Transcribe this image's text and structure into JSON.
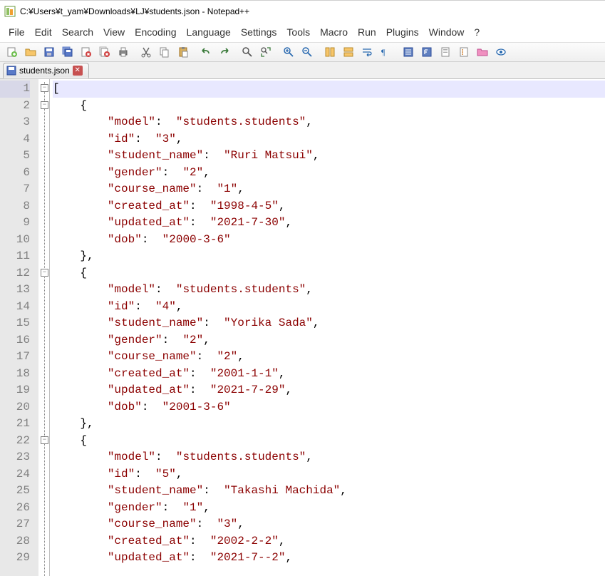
{
  "window": {
    "title": "C:¥Users¥t_yam¥Downloads¥LJ¥students.json - Notepad++"
  },
  "menu": {
    "file": "File",
    "edit": "Edit",
    "search": "Search",
    "view": "View",
    "encoding": "Encoding",
    "language": "Language",
    "settings": "Settings",
    "tools": "Tools",
    "macro": "Macro",
    "run": "Run",
    "plugins": "Plugins",
    "window": "Window",
    "help": "?"
  },
  "tab": {
    "label": "students.json"
  },
  "toolbar_icons": [
    "new-file-icon",
    "open-folder-icon",
    "save-icon",
    "save-all-icon",
    "close-icon",
    "close-all-icon",
    "print-icon",
    "cut-icon",
    "copy-icon",
    "paste-icon",
    "undo-icon",
    "redo-icon",
    "find-icon",
    "replace-icon",
    "zoom-in-icon",
    "zoom-out-icon",
    "sync-v-icon",
    "sync-h-icon",
    "wordwrap-icon",
    "allchars-icon",
    "indent-guide-icon",
    "lang-icon",
    "doc-map-icon",
    "func-list-icon",
    "folder-workspace-icon",
    "monitor-icon"
  ],
  "editor": {
    "gutter": [
      "1",
      "2",
      "3",
      "4",
      "5",
      "6",
      "7",
      "8",
      "9",
      "10",
      "11",
      "12",
      "13",
      "14",
      "15",
      "16",
      "17",
      "18",
      "19",
      "20",
      "21",
      "22",
      "23",
      "24",
      "25",
      "26",
      "27",
      "28",
      "29"
    ],
    "lines": [
      {
        "tokens": [
          {
            "t": "[",
            "c": "pun"
          }
        ],
        "indent": 0,
        "hl": true
      },
      {
        "tokens": [
          {
            "t": "{",
            "c": "pun"
          }
        ],
        "indent": 1
      },
      {
        "tokens": [
          {
            "t": "\"model\"",
            "c": "str"
          },
          {
            "t": ":  ",
            "c": "pun"
          },
          {
            "t": "\"students.students\"",
            "c": "str"
          },
          {
            "t": ",",
            "c": "pun"
          }
        ],
        "indent": 2
      },
      {
        "tokens": [
          {
            "t": "\"id\"",
            "c": "str"
          },
          {
            "t": ":  ",
            "c": "pun"
          },
          {
            "t": "\"3\"",
            "c": "str"
          },
          {
            "t": ",",
            "c": "pun"
          }
        ],
        "indent": 2
      },
      {
        "tokens": [
          {
            "t": "\"student_name\"",
            "c": "str"
          },
          {
            "t": ":  ",
            "c": "pun"
          },
          {
            "t": "\"Ruri Matsui\"",
            "c": "str"
          },
          {
            "t": ",",
            "c": "pun"
          }
        ],
        "indent": 2
      },
      {
        "tokens": [
          {
            "t": "\"gender\"",
            "c": "str"
          },
          {
            "t": ":  ",
            "c": "pun"
          },
          {
            "t": "\"2\"",
            "c": "str"
          },
          {
            "t": ",",
            "c": "pun"
          }
        ],
        "indent": 2
      },
      {
        "tokens": [
          {
            "t": "\"course_name\"",
            "c": "str"
          },
          {
            "t": ":  ",
            "c": "pun"
          },
          {
            "t": "\"1\"",
            "c": "str"
          },
          {
            "t": ",",
            "c": "pun"
          }
        ],
        "indent": 2
      },
      {
        "tokens": [
          {
            "t": "\"created_at\"",
            "c": "str"
          },
          {
            "t": ":  ",
            "c": "pun"
          },
          {
            "t": "\"1998-4-5\"",
            "c": "str"
          },
          {
            "t": ",",
            "c": "pun"
          }
        ],
        "indent": 2
      },
      {
        "tokens": [
          {
            "t": "\"updated_at\"",
            "c": "str"
          },
          {
            "t": ":  ",
            "c": "pun"
          },
          {
            "t": "\"2021-7-30\"",
            "c": "str"
          },
          {
            "t": ",",
            "c": "pun"
          }
        ],
        "indent": 2
      },
      {
        "tokens": [
          {
            "t": "\"dob\"",
            "c": "str"
          },
          {
            "t": ":  ",
            "c": "pun"
          },
          {
            "t": "\"2000-3-6\"",
            "c": "str"
          }
        ],
        "indent": 2
      },
      {
        "tokens": [
          {
            "t": "},",
            "c": "pun"
          }
        ],
        "indent": 1
      },
      {
        "tokens": [
          {
            "t": "{",
            "c": "pun"
          }
        ],
        "indent": 1
      },
      {
        "tokens": [
          {
            "t": "\"model\"",
            "c": "str"
          },
          {
            "t": ":  ",
            "c": "pun"
          },
          {
            "t": "\"students.students\"",
            "c": "str"
          },
          {
            "t": ",",
            "c": "pun"
          }
        ],
        "indent": 2
      },
      {
        "tokens": [
          {
            "t": "\"id\"",
            "c": "str"
          },
          {
            "t": ":  ",
            "c": "pun"
          },
          {
            "t": "\"4\"",
            "c": "str"
          },
          {
            "t": ",",
            "c": "pun"
          }
        ],
        "indent": 2
      },
      {
        "tokens": [
          {
            "t": "\"student_name\"",
            "c": "str"
          },
          {
            "t": ":  ",
            "c": "pun"
          },
          {
            "t": "\"Yorika Sada\"",
            "c": "str"
          },
          {
            "t": ",",
            "c": "pun"
          }
        ],
        "indent": 2
      },
      {
        "tokens": [
          {
            "t": "\"gender\"",
            "c": "str"
          },
          {
            "t": ":  ",
            "c": "pun"
          },
          {
            "t": "\"2\"",
            "c": "str"
          },
          {
            "t": ",",
            "c": "pun"
          }
        ],
        "indent": 2
      },
      {
        "tokens": [
          {
            "t": "\"course_name\"",
            "c": "str"
          },
          {
            "t": ":  ",
            "c": "pun"
          },
          {
            "t": "\"2\"",
            "c": "str"
          },
          {
            "t": ",",
            "c": "pun"
          }
        ],
        "indent": 2
      },
      {
        "tokens": [
          {
            "t": "\"created_at\"",
            "c": "str"
          },
          {
            "t": ":  ",
            "c": "pun"
          },
          {
            "t": "\"2001-1-1\"",
            "c": "str"
          },
          {
            "t": ",",
            "c": "pun"
          }
        ],
        "indent": 2
      },
      {
        "tokens": [
          {
            "t": "\"updated_at\"",
            "c": "str"
          },
          {
            "t": ":  ",
            "c": "pun"
          },
          {
            "t": "\"2021-7-29\"",
            "c": "str"
          },
          {
            "t": ",",
            "c": "pun"
          }
        ],
        "indent": 2
      },
      {
        "tokens": [
          {
            "t": "\"dob\"",
            "c": "str"
          },
          {
            "t": ":  ",
            "c": "pun"
          },
          {
            "t": "\"2001-3-6\"",
            "c": "str"
          }
        ],
        "indent": 2
      },
      {
        "tokens": [
          {
            "t": "},",
            "c": "pun"
          }
        ],
        "indent": 1
      },
      {
        "tokens": [
          {
            "t": "{",
            "c": "pun"
          }
        ],
        "indent": 1
      },
      {
        "tokens": [
          {
            "t": "\"model\"",
            "c": "str"
          },
          {
            "t": ":  ",
            "c": "pun"
          },
          {
            "t": "\"students.students\"",
            "c": "str"
          },
          {
            "t": ",",
            "c": "pun"
          }
        ],
        "indent": 2
      },
      {
        "tokens": [
          {
            "t": "\"id\"",
            "c": "str"
          },
          {
            "t": ":  ",
            "c": "pun"
          },
          {
            "t": "\"5\"",
            "c": "str"
          },
          {
            "t": ",",
            "c": "pun"
          }
        ],
        "indent": 2
      },
      {
        "tokens": [
          {
            "t": "\"student_name\"",
            "c": "str"
          },
          {
            "t": ":  ",
            "c": "pun"
          },
          {
            "t": "\"Takashi Machida\"",
            "c": "str"
          },
          {
            "t": ",",
            "c": "pun"
          }
        ],
        "indent": 2
      },
      {
        "tokens": [
          {
            "t": "\"gender\"",
            "c": "str"
          },
          {
            "t": ":  ",
            "c": "pun"
          },
          {
            "t": "\"1\"",
            "c": "str"
          },
          {
            "t": ",",
            "c": "pun"
          }
        ],
        "indent": 2
      },
      {
        "tokens": [
          {
            "t": "\"course_name\"",
            "c": "str"
          },
          {
            "t": ":  ",
            "c": "pun"
          },
          {
            "t": "\"3\"",
            "c": "str"
          },
          {
            "t": ",",
            "c": "pun"
          }
        ],
        "indent": 2
      },
      {
        "tokens": [
          {
            "t": "\"created_at\"",
            "c": "str"
          },
          {
            "t": ":  ",
            "c": "pun"
          },
          {
            "t": "\"2002-2-2\"",
            "c": "str"
          },
          {
            "t": ",",
            "c": "pun"
          }
        ],
        "indent": 2
      },
      {
        "tokens": [
          {
            "t": "\"updated_at\"",
            "c": "str"
          },
          {
            "t": ":  ",
            "c": "pun"
          },
          {
            "t": "\"2021-7--2\"",
            "c": "str"
          },
          {
            "t": ",",
            "c": "pun"
          }
        ],
        "indent": 2
      }
    ],
    "fold_boxes": [
      1,
      2,
      12,
      22
    ]
  }
}
